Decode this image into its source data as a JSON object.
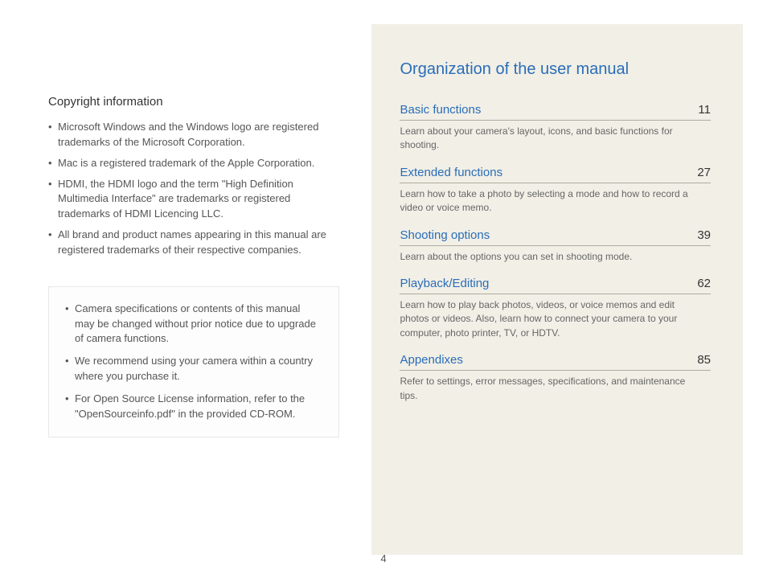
{
  "left": {
    "heading": "Copyright information",
    "bullets": [
      "Microsoft Windows and the Windows logo are registered trademarks of the Microsoft Corporation.",
      "Mac is a registered trademark of the Apple Corporation.",
      "HDMI, the HDMI logo and the term \"High Definition Multimedia Interface\" are trademarks or registered trademarks of HDMI Licencing LLC.",
      "All brand and product names appearing in this manual are registered trademarks of their respective companies."
    ],
    "note_bullets": [
      "Camera specifications or contents of this manual may be changed without prior notice due to upgrade of camera functions.",
      "We recommend using your camera within a country where you purchase it.",
      "For Open Source License information, refer to the \"OpenSourceinfo.pdf\" in the provided CD-ROM."
    ]
  },
  "right": {
    "heading": "Organization of the user manual",
    "toc": [
      {
        "title": "Basic functions",
        "page": "11",
        "desc": "Learn about your camera's layout, icons, and basic functions for shooting."
      },
      {
        "title": "Extended functions",
        "page": "27",
        "desc": "Learn how to take a photo by selecting a mode and how to record a video or voice memo."
      },
      {
        "title": "Shooting options",
        "page": "39",
        "desc": "Learn about the options you can set in shooting mode."
      },
      {
        "title": "Playback/Editing",
        "page": "62",
        "desc": "Learn how to play back photos, videos, or voice memos and edit photos or videos. Also, learn how to connect your camera to your computer, photo printer, TV, or HDTV."
      },
      {
        "title": "Appendixes",
        "page": "85",
        "desc": "Refer to settings, error messages, specifications, and maintenance tips."
      }
    ]
  },
  "page_number": "4"
}
